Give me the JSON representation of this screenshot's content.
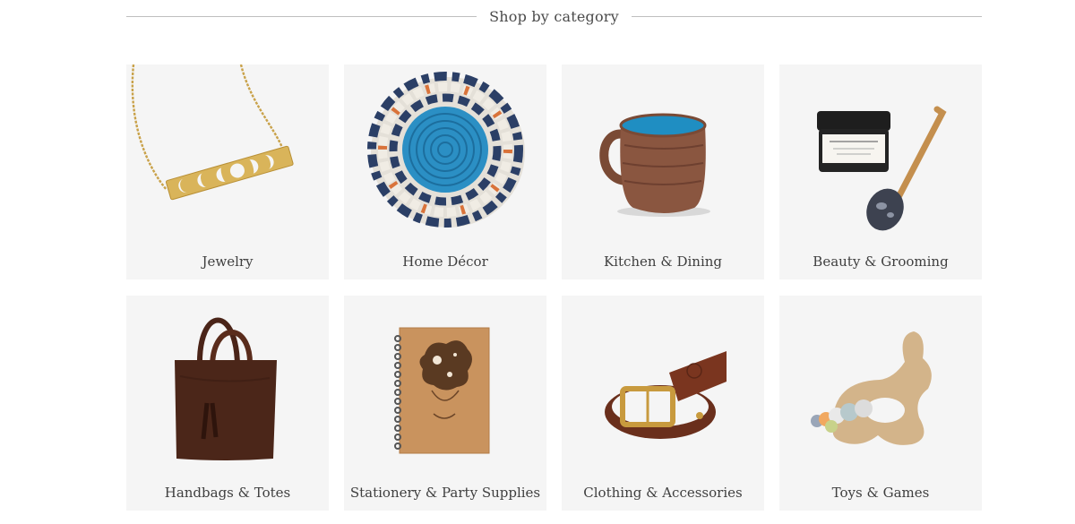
{
  "section": {
    "heading": "Shop by category"
  },
  "categories": [
    {
      "label": "Jewelry",
      "icon": "necklace-icon"
    },
    {
      "label": "Home Décor",
      "icon": "woven-basket-icon"
    },
    {
      "label": "Kitchen & Dining",
      "icon": "mug-icon"
    },
    {
      "label": "Beauty & Grooming",
      "icon": "jar-and-spoon-icon"
    },
    {
      "label": "Handbags & Totes",
      "icon": "tote-bag-icon"
    },
    {
      "label": "Stationery & Party Supplies",
      "icon": "wooden-journal-icon"
    },
    {
      "label": "Clothing & Accessories",
      "icon": "leather-belt-icon"
    },
    {
      "label": "Toys & Games",
      "icon": "bunny-teether-icon"
    }
  ],
  "colors": {
    "tile_background": "#f5f5f5",
    "rule": "#bfbfbf",
    "text": "#3f3f3f"
  }
}
